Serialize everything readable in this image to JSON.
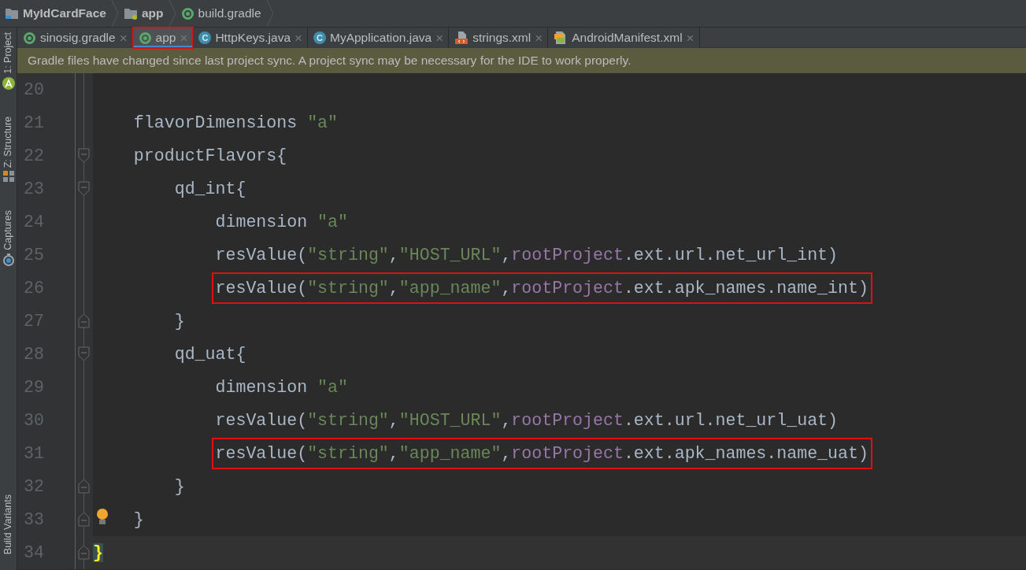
{
  "breadcrumbs": [
    {
      "label": "MyIdCardFace",
      "kind": "project"
    },
    {
      "label": "app",
      "kind": "module"
    },
    {
      "label": "build.gradle",
      "kind": "gradle"
    }
  ],
  "sidebar_tools": [
    {
      "label": "1: Project",
      "kind": "android"
    },
    {
      "label": "Z: Structure",
      "kind": "structure"
    },
    {
      "label": "Captures",
      "kind": "captures"
    },
    {
      "label": "Build Variants",
      "kind": "plain"
    }
  ],
  "tabs": [
    {
      "label": "sinosig.gradle",
      "kind": "gradle",
      "selected": false,
      "outlined": false
    },
    {
      "label": "app",
      "kind": "gradle",
      "selected": true,
      "outlined": true
    },
    {
      "label": "HttpKeys.java",
      "kind": "class",
      "icon_text": "C",
      "selected": false,
      "outlined": false
    },
    {
      "label": "MyApplication.java",
      "kind": "class",
      "icon_text": "C",
      "selected": false,
      "outlined": false
    },
    {
      "label": "strings.xml",
      "kind": "xml",
      "selected": false,
      "outlined": false
    },
    {
      "label": "AndroidManifest.xml",
      "kind": "manifest",
      "selected": false,
      "outlined": false
    }
  ],
  "tab_close": "×",
  "notification": "Gradle files have changed since last project sync. A project sync may be necessary for the IDE to work properly.",
  "lines": [
    {
      "number": "20",
      "kind": "plain",
      "boxed": false,
      "current": false,
      "bulb": false
    },
    {
      "number": "21",
      "tokens": [
        {
          "kind": "plain",
          "text": "    flavorDimensions "
        },
        {
          "kind": "string",
          "text": "\"a\""
        }
      ],
      "kind": "plain",
      "boxed": false,
      "current": false,
      "bulb": false
    },
    {
      "number": "22",
      "tokens": [
        {
          "kind": "plain",
          "text": "    productFlavors{"
        }
      ],
      "kind": "fold_start",
      "boxed": false,
      "current": false,
      "bulb": false
    },
    {
      "number": "23",
      "tokens": [
        {
          "kind": "plain",
          "text": "        qd_int{"
        }
      ],
      "kind": "fold_start",
      "boxed": false,
      "current": false,
      "bulb": false
    },
    {
      "number": "24",
      "tokens": [
        {
          "kind": "plain",
          "text": "            dimension "
        },
        {
          "kind": "string",
          "text": "\"a\""
        }
      ],
      "kind": "plain",
      "boxed": false,
      "current": false,
      "bulb": false
    },
    {
      "number": "25",
      "tokens": [
        {
          "kind": "plain",
          "text": "            resValue("
        },
        {
          "kind": "string",
          "text": "\"string\""
        },
        {
          "kind": "plain",
          "text": ","
        },
        {
          "kind": "string",
          "text": "\"HOST_URL\""
        },
        {
          "kind": "plain",
          "text": ","
        },
        {
          "kind": "field",
          "text": "rootProject"
        },
        {
          "kind": "plain",
          "text": ".ext.url.net_url_int)"
        }
      ],
      "kind": "plain",
      "boxed": false,
      "current": false,
      "bulb": false
    },
    {
      "number": "26",
      "tokens": [
        {
          "kind": "plain",
          "text": "            resValue("
        },
        {
          "kind": "string",
          "text": "\"string\""
        },
        {
          "kind": "plain",
          "text": ","
        },
        {
          "kind": "string",
          "text": "\"app_name\""
        },
        {
          "kind": "plain",
          "text": ","
        },
        {
          "kind": "field",
          "text": "rootProject"
        },
        {
          "kind": "plain",
          "text": ".ext.apk_names.name_int)"
        }
      ],
      "kind": "plain",
      "boxed": true,
      "current": false,
      "bulb": false
    },
    {
      "number": "27",
      "tokens": [
        {
          "kind": "plain",
          "text": "        }"
        }
      ],
      "kind": "fold_end",
      "boxed": false,
      "current": false,
      "bulb": false
    },
    {
      "number": "28",
      "tokens": [
        {
          "kind": "plain",
          "text": "        qd_uat{"
        }
      ],
      "kind": "fold_start",
      "boxed": false,
      "current": false,
      "bulb": false
    },
    {
      "number": "29",
      "tokens": [
        {
          "kind": "plain",
          "text": "            dimension "
        },
        {
          "kind": "string",
          "text": "\"a\""
        }
      ],
      "kind": "plain",
      "boxed": false,
      "current": false,
      "bulb": false
    },
    {
      "number": "30",
      "tokens": [
        {
          "kind": "plain",
          "text": "            resValue("
        },
        {
          "kind": "string",
          "text": "\"string\""
        },
        {
          "kind": "plain",
          "text": ","
        },
        {
          "kind": "string",
          "text": "\"HOST_URL\""
        },
        {
          "kind": "plain",
          "text": ","
        },
        {
          "kind": "field",
          "text": "rootProject"
        },
        {
          "kind": "plain",
          "text": ".ext.url.net_url_uat)"
        }
      ],
      "kind": "plain",
      "boxed": false,
      "current": false,
      "bulb": false
    },
    {
      "number": "31",
      "tokens": [
        {
          "kind": "plain",
          "text": "            resValue("
        },
        {
          "kind": "string",
          "text": "\"string\""
        },
        {
          "kind": "plain",
          "text": ","
        },
        {
          "kind": "string",
          "text": "\"app_name\""
        },
        {
          "kind": "plain",
          "text": ","
        },
        {
          "kind": "field",
          "text": "rootProject"
        },
        {
          "kind": "plain",
          "text": ".ext.apk_names.name_uat)"
        }
      ],
      "kind": "plain",
      "boxed": true,
      "current": false,
      "bulb": false
    },
    {
      "number": "32",
      "tokens": [
        {
          "kind": "plain",
          "text": "        }"
        }
      ],
      "kind": "fold_end",
      "boxed": false,
      "current": false,
      "bulb": false
    },
    {
      "number": "33",
      "tokens": [
        {
          "kind": "plain",
          "text": "    }"
        }
      ],
      "kind": "fold_end",
      "boxed": false,
      "current": false,
      "bulb": true
    },
    {
      "number": "34",
      "tokens": [
        {
          "kind": "brace_match",
          "text": "}"
        }
      ],
      "kind": "fold_end",
      "boxed": false,
      "current": true,
      "bulb": false
    }
  ]
}
